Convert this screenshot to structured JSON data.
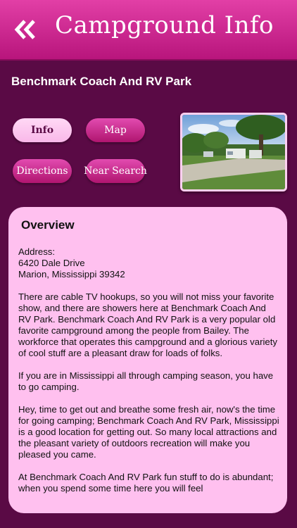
{
  "header": {
    "title": "Campground Info",
    "back_icon": "double-chevron-left-icon"
  },
  "park_name": "Benchmark Coach And RV Park",
  "buttons": {
    "info": "Info",
    "map": "Map",
    "directions": "Directions",
    "near_search": "Near Search"
  },
  "overview": {
    "title": "Overview",
    "address_label": "Address:",
    "address_line1": "6420 Dale Drive",
    "address_line2": "Marion, Mississippi 39342",
    "paragraphs": [
      "There are cable TV hookups, so you will not miss your favorite show, and there are showers here at Benchmark Coach And RV Park. Benchmark Coach And RV Park is a very popular old favorite campground among the people from Bailey. The workforce that operates this campground and a glorious variety of cool stuff are a pleasant draw for loads of folks.",
      "If you are in Mississippi all through camping season, you have to go camping.",
      "Hey, time to get out and breathe some fresh air, now's the time for going camping; Benchmark Coach And RV Park, Mississippi is a good location for getting out. So many local attractions and the pleasant variety of outdoors recreation will make you pleased you came.",
      "At Benchmark Coach And RV Park fun stuff to do is abundant; when you spend some time here you will feel"
    ]
  },
  "colors": {
    "background": "#5a0a45",
    "header": "#c81f8c",
    "panel": "#ffc0ef"
  }
}
